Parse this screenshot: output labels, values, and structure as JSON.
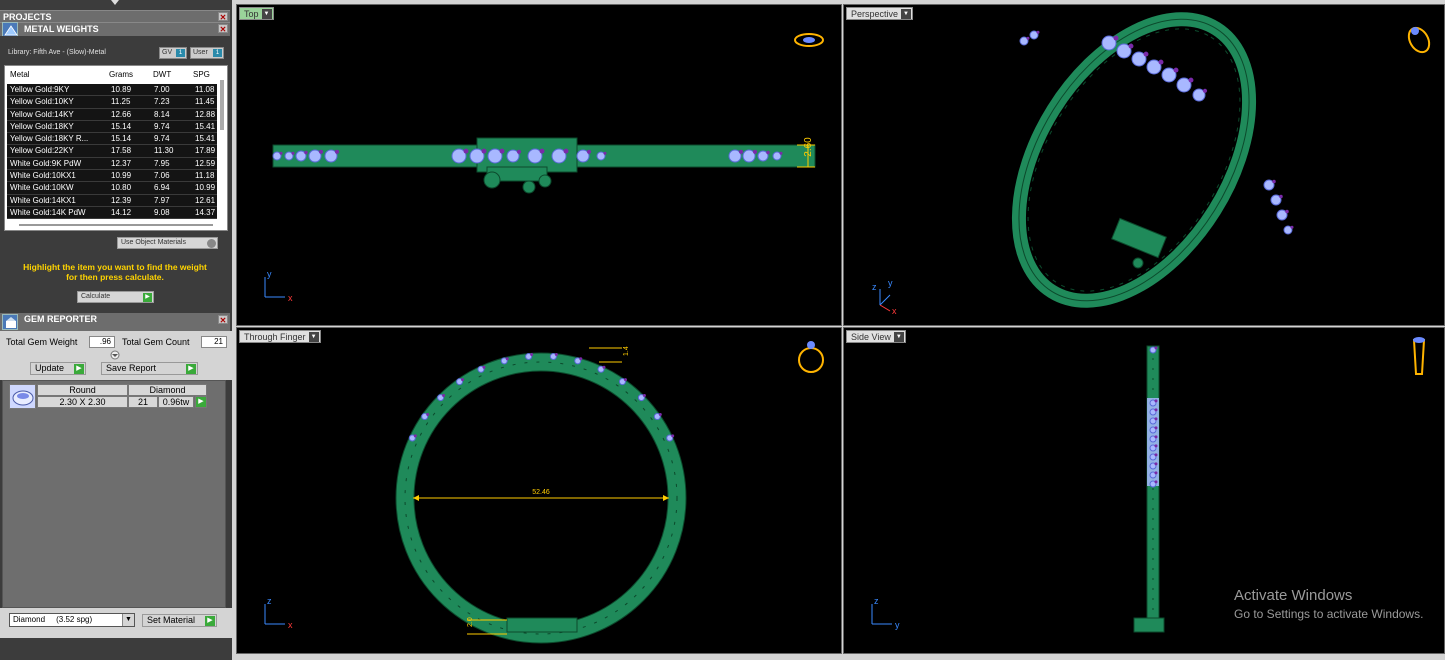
{
  "projects_panel": {
    "title": "PROJECTS"
  },
  "metal_weights": {
    "title": "METAL WEIGHTS",
    "library": "Library: Fifth Ave - (Slow)-Metal",
    "toggle_gv": "GV",
    "toggle_user": "User",
    "toggle_gv_key": "1",
    "toggle_user_key": "1",
    "columns": [
      "Metal",
      "Grams",
      "DWT",
      "SPG"
    ],
    "rows": [
      [
        "Yellow Gold:9KY",
        "10.89",
        "7.00",
        "11.08"
      ],
      [
        "Yellow Gold:10KY",
        "11.25",
        "7.23",
        "11.45"
      ],
      [
        "Yellow Gold:14KY",
        "12.66",
        "8.14",
        "12.88"
      ],
      [
        "Yellow Gold:18KY",
        "15.14",
        "9.74",
        "15.41"
      ],
      [
        "Yellow Gold:18KY R...",
        "15.14",
        "9.74",
        "15.41"
      ],
      [
        "Yellow Gold:22KY",
        "17.58",
        "11.30",
        "17.89"
      ],
      [
        "White Gold:9K PdW",
        "12.37",
        "7.95",
        "12.59"
      ],
      [
        "White Gold:10KX1",
        "10.99",
        "7.06",
        "11.18"
      ],
      [
        "White Gold:10KW",
        "10.80",
        "6.94",
        "10.99"
      ],
      [
        "White Gold:14KX1",
        "12.39",
        "7.97",
        "12.61"
      ],
      [
        "White Gold:14K PdW",
        "14.12",
        "9.08",
        "14.37"
      ]
    ],
    "use_object_materials": "Use Object Materials",
    "hint_line1": "Highlight the item you want to find the weight",
    "hint_line2": "for then press calculate.",
    "calculate": "Calculate"
  },
  "gem_reporter": {
    "title": "GEM REPORTER",
    "total_gem_weight_label": "Total Gem Weight",
    "total_gem_weight": ".96",
    "total_gem_count_label": "Total Gem Count",
    "total_gem_count": "21",
    "update": "Update",
    "save_report": "Save Report",
    "gem": {
      "shape": "Round",
      "size": "2.30 X 2.30",
      "material": "Diamond",
      "count": "21",
      "weight": "0.96tw"
    },
    "material_select": "Diamond     (3.52 spg)",
    "set_material": "Set Material"
  },
  "viewports": {
    "top": {
      "label": "Top",
      "dimension": "2.60",
      "axis_y": "y",
      "axis_x": "x"
    },
    "perspective": {
      "label": "Perspective",
      "axis_z": "z",
      "axis_y": "y",
      "axis_x": "x"
    },
    "through_finger": {
      "label": "Through Finger",
      "dimension": "52.46",
      "dim_small_top": "1.4",
      "dim_small_bottom": "2.0",
      "axis_z": "z",
      "axis_x": "x"
    },
    "side_view": {
      "label": "Side View",
      "axis_z": "z",
      "axis_y": "y"
    }
  },
  "watermark": {
    "line1": "Activate Windows",
    "line2": "Go to Settings to activate Windows."
  },
  "colors": {
    "metal": "#1f8a5a",
    "gem": "#a8b8ff",
    "prong": "#7a2aa8",
    "dimension": "#ffcc00",
    "active_label": "#9ad39a"
  }
}
